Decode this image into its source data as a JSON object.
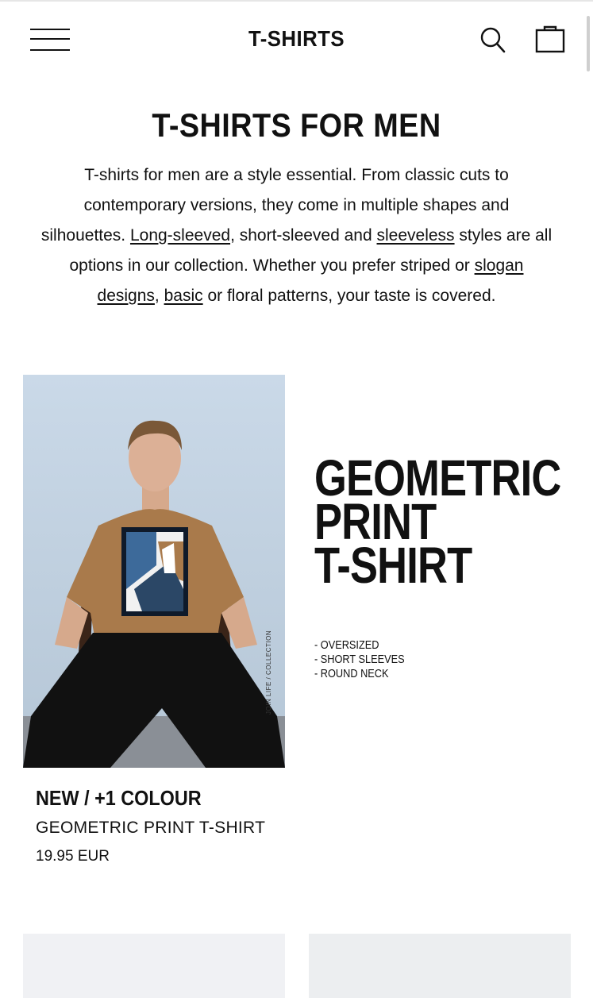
{
  "header": {
    "title": "T-SHIRTS",
    "menu_icon": "hamburger-menu-icon",
    "search_icon": "search-icon",
    "bag_icon": "shopping-bag-icon"
  },
  "intro": {
    "heading": "T-SHIRTS FOR MEN",
    "text_1": "T-shirts for men are a style essential. From classic cuts to contemporary versions, they come in multiple shapes and silhouettes. ",
    "link_long_sleeved": "Long-sleeved",
    "text_2": ", short-sleeved and ",
    "link_sleeveless": "sleeveless",
    "text_3": " styles are all options in our collection. Whether you prefer striped or ",
    "link_slogan": "slogan designs",
    "text_4": ", ",
    "link_basic": "basic",
    "text_5": " or floral patterns, your taste is covered."
  },
  "product": {
    "badge": "NEW / +1 COLOUR",
    "name": "GEOMETRIC PRINT T-SHIRT",
    "price": "19.95 EUR",
    "image_caption": "JOIN LIFE / COLLECTION"
  },
  "promo": {
    "title_lines": [
      "GEOMETRIC",
      "PRINT",
      "T-SHIRT"
    ],
    "features": [
      "- OVERSIZED",
      "- SHORT SLEEVES",
      "- ROUND NECK"
    ]
  },
  "colors": {
    "background": "#ffffff",
    "text": "#111111",
    "image_bg": "#c5d6e6",
    "shirt": "#a97a4b"
  }
}
